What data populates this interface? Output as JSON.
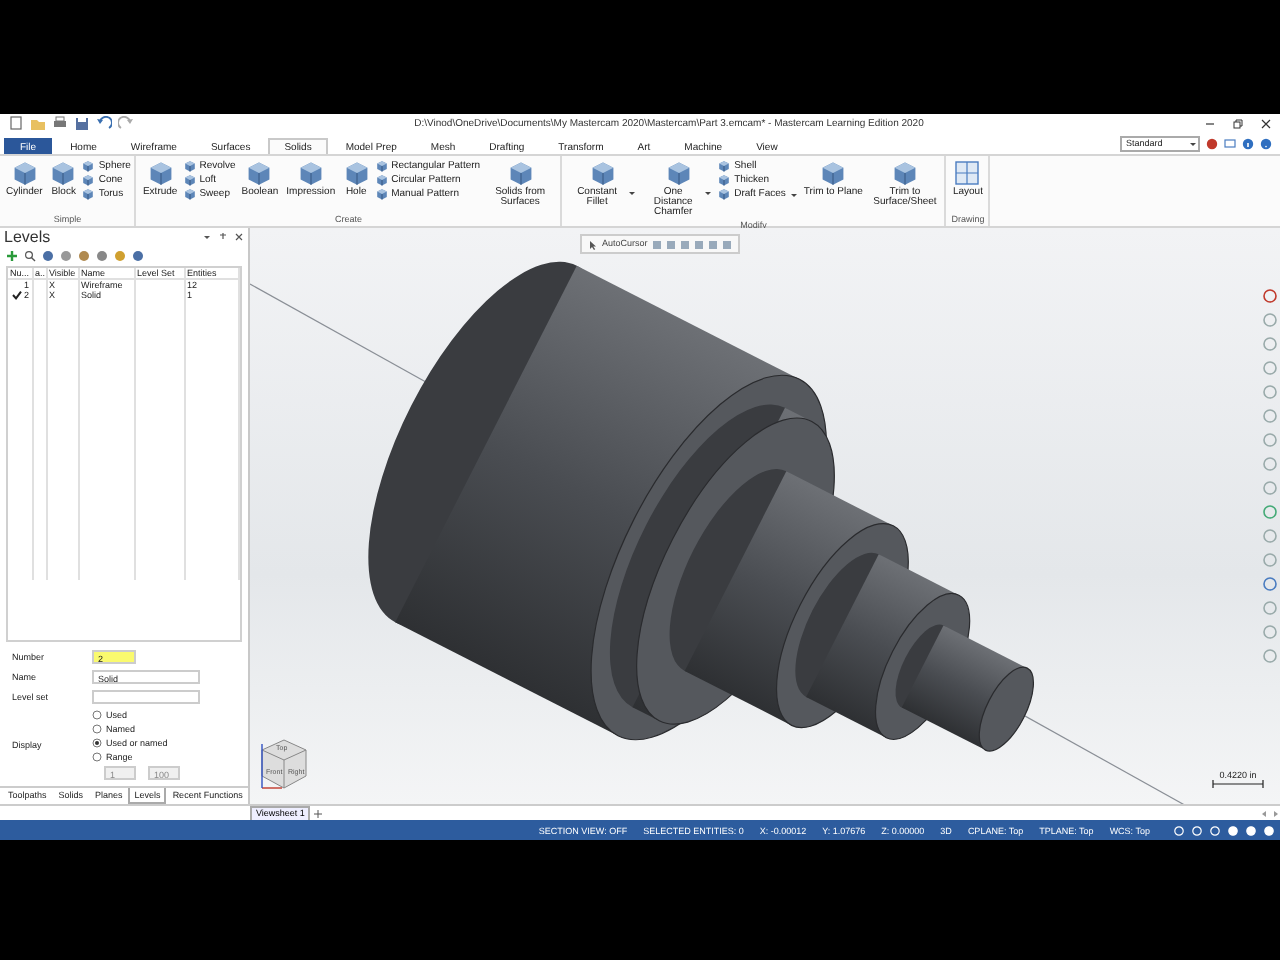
{
  "window": {
    "title": "D:\\Vinod\\OneDrive\\Documents\\My Mastercam 2020\\Mastercam\\Part 3.emcam* - Mastercam Learning Edition 2020"
  },
  "ribbon": {
    "tabs": [
      {
        "label": "File",
        "kind": "file",
        "selected": false
      },
      {
        "label": "Home",
        "kind": "tab",
        "selected": false
      },
      {
        "label": "Wireframe",
        "kind": "tab",
        "selected": false
      },
      {
        "label": "Surfaces",
        "kind": "tab",
        "selected": false
      },
      {
        "label": "Solids",
        "kind": "tab",
        "selected": true
      },
      {
        "label": "Model Prep",
        "kind": "tab",
        "selected": false
      },
      {
        "label": "Mesh",
        "kind": "tab",
        "selected": false
      },
      {
        "label": "Drafting",
        "kind": "tab",
        "selected": false
      },
      {
        "label": "Transform",
        "kind": "tab",
        "selected": false
      },
      {
        "label": "Art",
        "kind": "tab",
        "selected": false
      },
      {
        "label": "Machine",
        "kind": "tab",
        "selected": false
      },
      {
        "label": "View",
        "kind": "tab",
        "selected": false
      }
    ],
    "style_box": {
      "value": "Standard"
    },
    "groups": [
      {
        "label": "Simple",
        "items": [
          {
            "label": "Cylinder",
            "kind": "large",
            "dropdown": false
          },
          {
            "label": "Block",
            "kind": "large",
            "dropdown": false
          },
          {
            "label": "Sphere",
            "kind": "small",
            "dropdown": false
          },
          {
            "label": "Cone",
            "kind": "small",
            "dropdown": false
          },
          {
            "label": "Torus",
            "kind": "small",
            "dropdown": false
          }
        ]
      },
      {
        "label": "Create",
        "items": [
          {
            "label": "Extrude",
            "kind": "large",
            "dropdown": false
          },
          {
            "label": "Revolve",
            "kind": "small",
            "dropdown": false
          },
          {
            "label": "Loft",
            "kind": "small",
            "dropdown": false
          },
          {
            "label": "Sweep",
            "kind": "small",
            "dropdown": false
          },
          {
            "label": "Boolean",
            "kind": "large",
            "dropdown": false
          },
          {
            "label": "Impression",
            "kind": "large",
            "dropdown": false
          },
          {
            "label": "Hole",
            "kind": "large",
            "dropdown": false
          },
          {
            "label": "Rectangular Pattern",
            "kind": "small",
            "dropdown": false
          },
          {
            "label": "Circular Pattern",
            "kind": "small",
            "dropdown": false
          },
          {
            "label": "Manual Pattern",
            "kind": "small",
            "dropdown": false
          },
          {
            "label": "Solids from Surfaces",
            "kind": "large",
            "dropdown": false
          }
        ]
      },
      {
        "label": "Modify",
        "items": [
          {
            "label": "Constant Fillet",
            "kind": "large",
            "dropdown": true
          },
          {
            "label": "One Distance Chamfer",
            "kind": "large",
            "dropdown": true
          },
          {
            "label": "Shell",
            "kind": "small",
            "dropdown": false
          },
          {
            "label": "Thicken",
            "kind": "small",
            "dropdown": false
          },
          {
            "label": "Draft Faces",
            "kind": "small",
            "dropdown": true
          },
          {
            "label": "Trim to Plane",
            "kind": "large",
            "dropdown": false
          },
          {
            "label": "Trim to Surface/Sheet",
            "kind": "large",
            "dropdown": false
          }
        ]
      },
      {
        "label": "Drawing",
        "items": [
          {
            "label": "Layout",
            "kind": "large",
            "dropdown": false
          }
        ]
      }
    ]
  },
  "levels_panel": {
    "title": "Levels",
    "columns": [
      "Nu...",
      "a..",
      "Visible",
      "Name",
      "Level Set",
      "Entities"
    ],
    "rows": [
      {
        "number": "1",
        "visible": "X",
        "name": "Wireframe",
        "entities": "12",
        "active": false
      },
      {
        "number": "2",
        "visible": "X",
        "name": "Solid",
        "entities": "1",
        "active": true
      }
    ],
    "number": {
      "label": "Number",
      "value": "2"
    },
    "name": {
      "label": "Name",
      "value": "Solid"
    },
    "level_set": {
      "label": "Level set"
    },
    "display": {
      "label": "Display",
      "options": [
        {
          "label": "Used",
          "selected": false
        },
        {
          "label": "Named",
          "selected": false
        },
        {
          "label": "Used or named",
          "selected": true
        },
        {
          "label": "Range",
          "selected": false
        }
      ],
      "range_from": "1",
      "range_to": "100"
    },
    "tabs": [
      {
        "label": "Toolpaths",
        "selected": false
      },
      {
        "label": "Solids",
        "selected": false
      },
      {
        "label": "Planes",
        "selected": false
      },
      {
        "label": "Levels",
        "selected": true
      },
      {
        "label": "Recent Functions",
        "selected": false
      }
    ]
  },
  "viewport": {
    "toolbar_label": "AutoCursor",
    "scale_label": "0.4220 in",
    "cube_faces": [
      "Top",
      "Front",
      "Right"
    ]
  },
  "viewsheets": [
    {
      "label": "Viewsheet 1",
      "selected": true
    }
  ],
  "status_bar": [
    "SECTION VIEW: OFF",
    "SELECTED ENTITIES: 0",
    "X: -0.00012",
    "Y: 1.07676",
    "Z: 0.00000",
    "3D",
    "CPLANE: Top",
    "TPLANE: Top",
    "WCS: Top"
  ]
}
